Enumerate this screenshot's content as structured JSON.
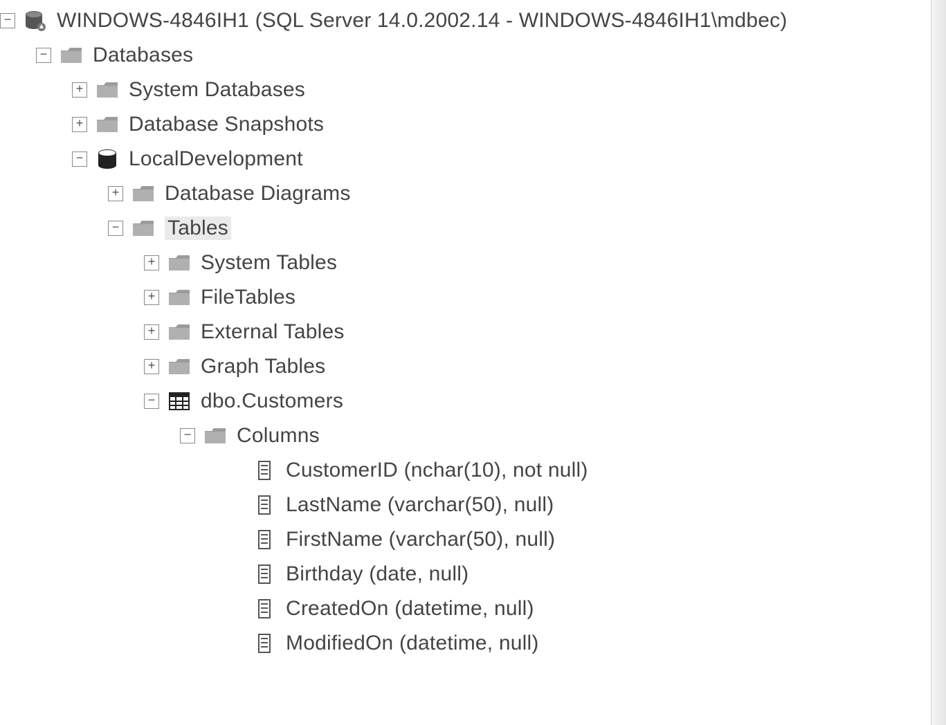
{
  "server": {
    "label": "WINDOWS-4846IH1 (SQL Server 14.0.2002.14 - WINDOWS-4846IH1\\mdbec)"
  },
  "databases": {
    "label": "Databases",
    "system_databases": "System Databases",
    "snapshots": "Database Snapshots",
    "local": {
      "label": "LocalDevelopment",
      "diagrams": "Database Diagrams",
      "tables": {
        "label": "Tables",
        "system_tables": "System Tables",
        "file_tables": "FileTables",
        "external_tables": "External Tables",
        "graph_tables": "Graph Tables",
        "customers": {
          "label": "dbo.Customers",
          "columns_label": "Columns",
          "columns": [
            "CustomerID (nchar(10), not null)",
            "LastName (varchar(50), null)",
            "FirstName (varchar(50), null)",
            "Birthday (date, null)",
            "CreatedOn (datetime, null)",
            "ModifiedOn (datetime, null)"
          ]
        }
      }
    }
  },
  "glyphs": {
    "plus": "+",
    "minus": "−"
  }
}
